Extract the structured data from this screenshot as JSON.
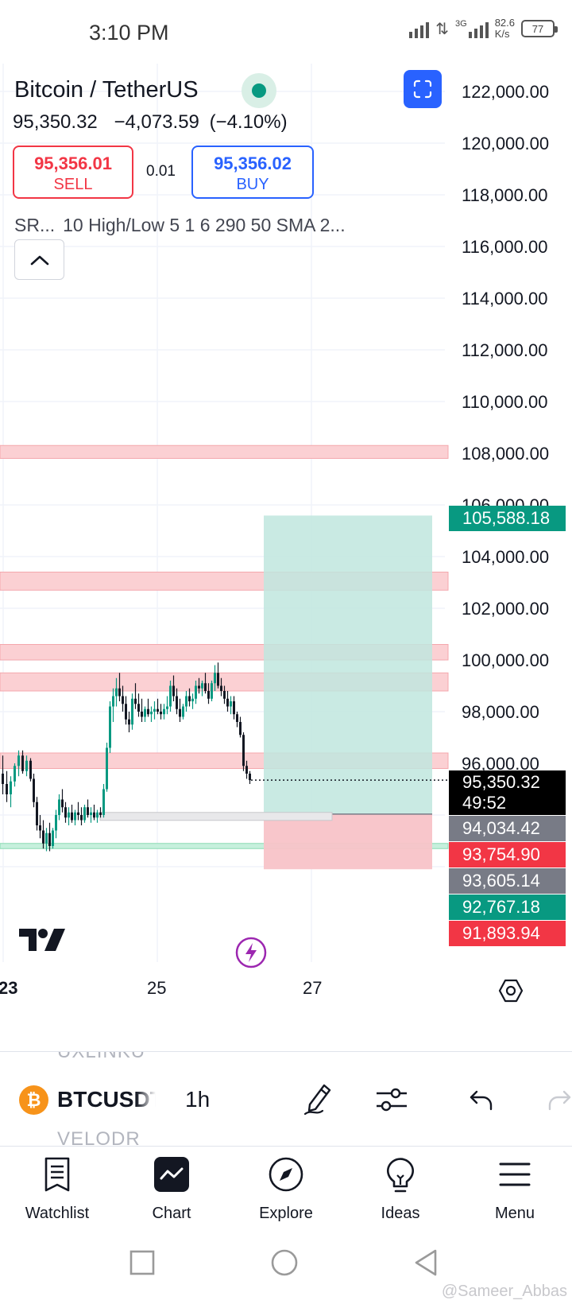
{
  "status_bar": {
    "time": "3:10 PM",
    "network": "3G",
    "speed_value": "82.6",
    "speed_unit": "K/s",
    "battery": "77"
  },
  "symbol": {
    "name": "Bitcoin / TetherUS",
    "last_price": "95,350.32",
    "change": "−4,073.59",
    "change_pct": "(−4.10%)",
    "sell_price": "95,356.01",
    "sell_label": "SELL",
    "spread": "0.01",
    "buy_price": "95,356.02",
    "buy_label": "BUY",
    "indicators_short": "SR...",
    "indicators_text": "10 High/Low 5 1 6 290 50 SMA 2..."
  },
  "chart": {
    "price_axis": [
      "122,000.00",
      "120,000.00",
      "118,000.00",
      "116,000.00",
      "114,000.00",
      "112,000.00",
      "110,000.00",
      "108,000.00",
      "106,000.00",
      "104,000.00",
      "102,000.00",
      "100,000.00",
      "98,000.00",
      "96,000.00"
    ],
    "time_axis": [
      "23",
      "25",
      "27"
    ],
    "tags": {
      "target": "105,588.18",
      "last": "95,350.32",
      "countdown": "49:52",
      "entry": "94,034.42",
      "stop": "93,754.90",
      "level_gray": "93,605.14",
      "level_green": "92,767.18",
      "level_red": "91,893.94"
    },
    "colors": {
      "up": "#089981",
      "down": "#f23645",
      "zone_red": "#f8c6c9",
      "zone_green": "#bfe6de"
    }
  },
  "toolbar": {
    "ghost_top": "UXLINKU",
    "symbol": "BTCUSDT",
    "ghost_bottom": "VELODR",
    "interval": "1h",
    "icons": [
      "draw-pen-icon",
      "indicators-sliders-icon",
      "undo-icon",
      "redo-icon"
    ]
  },
  "nav": {
    "watchlist": "Watchlist",
    "chart": "Chart",
    "explore": "Explore",
    "ideas": "Ideas",
    "menu": "Menu"
  },
  "watermark": "@Sameer_Abbas"
}
